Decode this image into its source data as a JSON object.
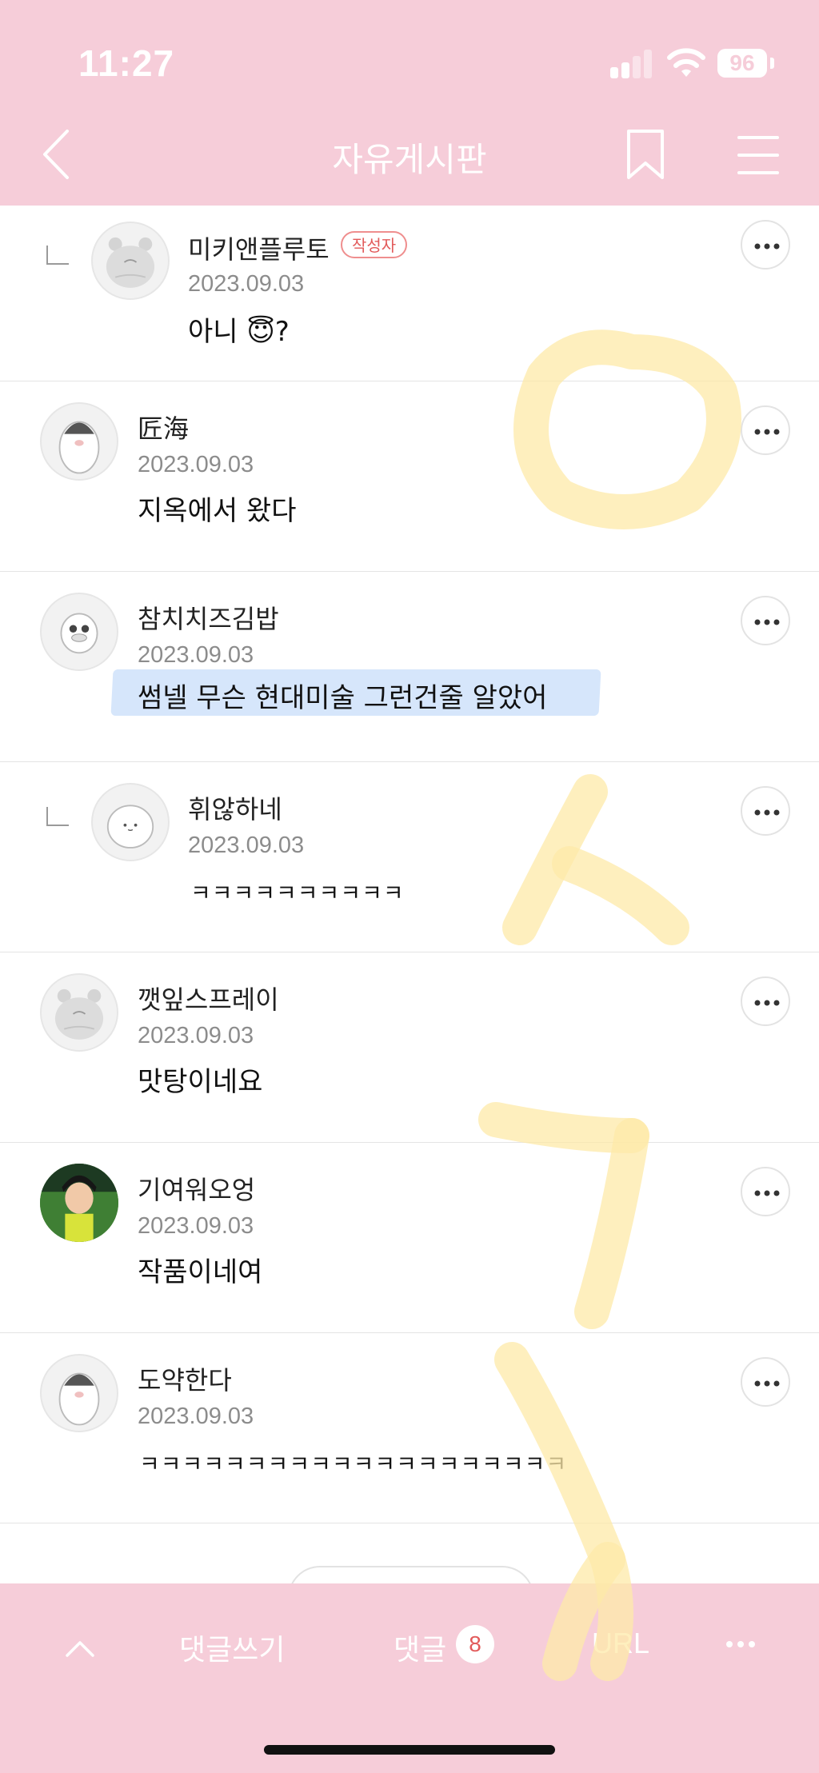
{
  "status_bar": {
    "time": "11:27",
    "battery": "96"
  },
  "header": {
    "title": "자유게시판"
  },
  "comments": [
    {
      "nickname": "미키앤플루토",
      "badge": "작성자",
      "date": "2023.09.03",
      "text": "아니 😇?",
      "reply": true,
      "avatar": "hamster-avatar"
    },
    {
      "nickname": "匠海",
      "date": "2023.09.03",
      "text": "지옥에서 왔다",
      "reply": false,
      "avatar": "penguin-avatar"
    },
    {
      "nickname": "참치치즈김밥",
      "date": "2023.09.03",
      "text": "썸넬 무슨 현대미술 그런건줄 알았어",
      "reply": false,
      "avatar": "duck-avatar"
    },
    {
      "nickname": "휘않하네",
      "date": "2023.09.03",
      "text": "ㅋㅋㅋㅋㅋㅋㅋㅋㅋㅋ",
      "reply": true,
      "avatar": "blob-avatar"
    },
    {
      "nickname": "깻잎스프레이",
      "date": "2023.09.03",
      "text": "맛탕이네요",
      "reply": false,
      "avatar": "hamster-avatar"
    },
    {
      "nickname": "기여워오엉",
      "date": "2023.09.03",
      "text": "작품이네여",
      "reply": false,
      "avatar": "photo-avatar"
    },
    {
      "nickname": "도약한다",
      "date": "2023.09.03",
      "text": "ㅋㅋㅋㅋㅋㅋㅋㅋㅋㅋㅋㅋㅋㅋㅋㅋㅋㅋㅋㅋ",
      "reply": false,
      "avatar": "penguin-avatar"
    }
  ],
  "tabbar": {
    "write_label": "댓글쓰기",
    "comments_label": "댓글",
    "comment_count": "8",
    "url_label": "URL"
  },
  "colors": {
    "accent": "#f6cdd9",
    "badge_red": "#e25a5a",
    "highlight": "#d6e6fb",
    "watermark": "#fde9a8"
  },
  "icons": [
    "back-arrow-icon",
    "bookmark-icon",
    "hamburger-menu-icon",
    "more-dots-icon",
    "chevron-up-icon",
    "signal-icon",
    "wifi-icon",
    "battery-icon"
  ]
}
